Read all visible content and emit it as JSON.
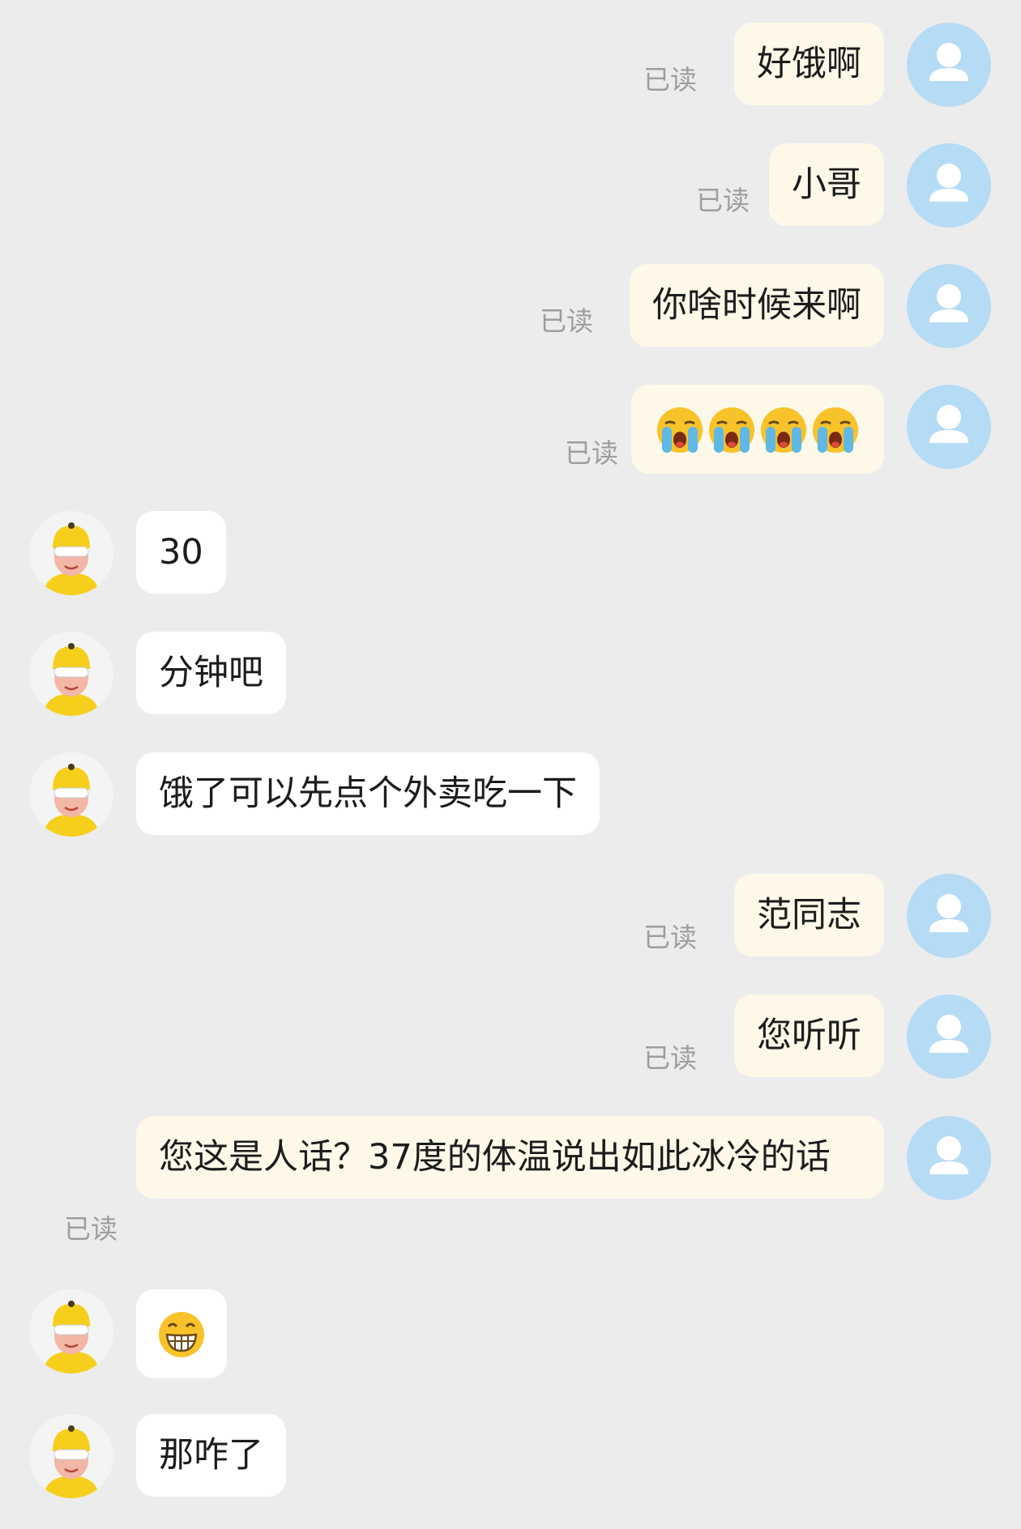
{
  "chat": {
    "messages": [
      {
        "side": "right",
        "text": "好饿啊",
        "status": "已读"
      },
      {
        "side": "right",
        "text": "小哥",
        "status": "已读"
      },
      {
        "side": "right",
        "text": "你啥时候来啊",
        "status": "已读"
      },
      {
        "side": "right",
        "emoji": "loudly-crying-face",
        "emoji_count": 4,
        "status": "已读"
      },
      {
        "side": "left",
        "text": "30"
      },
      {
        "side": "left",
        "text": "分钟吧"
      },
      {
        "side": "left",
        "text": "饿了可以先点个外卖吃一下"
      },
      {
        "side": "right",
        "text": "范同志",
        "status": "已读"
      },
      {
        "side": "right",
        "text": "您听听",
        "status": "已读"
      },
      {
        "side": "right",
        "text": "您这是人话？37度的体温说出如此冰冷的话",
        "status": "已读"
      },
      {
        "side": "left",
        "emoji": "grinning-face"
      },
      {
        "side": "left",
        "text": "那咋了"
      }
    ]
  },
  "colors": {
    "background": "#ececec",
    "sent_bubble": "#fdf8e8",
    "received_bubble": "#ffffff",
    "user_avatar": "#b6dbf5",
    "rider_helmet": "#f6cf1c",
    "read_status": "#9e9e9e"
  }
}
